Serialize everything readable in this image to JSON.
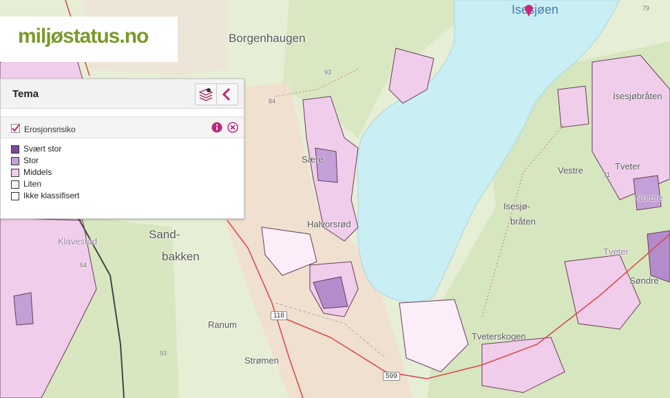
{
  "app": {
    "logo_text": "miljøstatus.no"
  },
  "panel": {
    "title": "Tema",
    "layer": {
      "name": "Erosjonsrisiko",
      "checked": true
    },
    "legend": [
      {
        "label": "Svært stor",
        "color": "#7b4a9a"
      },
      {
        "label": "Stor",
        "color": "#c3a0d8"
      },
      {
        "label": "Middels",
        "color": "#f0cdea"
      },
      {
        "label": "Liten",
        "color": "#fbeef8"
      },
      {
        "label": "Ikke klassifisert",
        "color": "#ffffff"
      }
    ],
    "icons": {
      "layers": "layers-icon",
      "back": "chevron-left-icon",
      "info": "info-icon",
      "remove": "close-circle-icon",
      "check": "checkmark-icon"
    },
    "accent_color": "#c0267a"
  },
  "map": {
    "lake_name": "Isesjøen",
    "places": {
      "borgenhaugen": "Borgenhaugen",
      "sand": "Sand-",
      "bakken": "bakken",
      "klavestad": "Klavestad",
      "saere": "Sære",
      "halvorsrod": "Halvorsrød",
      "ranum": "Ranum",
      "strommen": "Strømen",
      "isesjobraten_a": "Isesjø-",
      "isesjobraten_b": "bråten",
      "isesjobraten": "Isesjøbråten",
      "vestre": "Vestre",
      "tveter": "Tveter",
      "tveter2": "Tveter",
      "tveterskogen": "Tveterskogen",
      "nordre": "Nordre",
      "sondre": "Søndre"
    },
    "elevations": {
      "e93a": "93",
      "e84": "84",
      "e54": "54",
      "e93b": "93",
      "e79": "79",
      "e71": "71"
    },
    "roads": {
      "r118": "118",
      "r599": "599"
    }
  }
}
